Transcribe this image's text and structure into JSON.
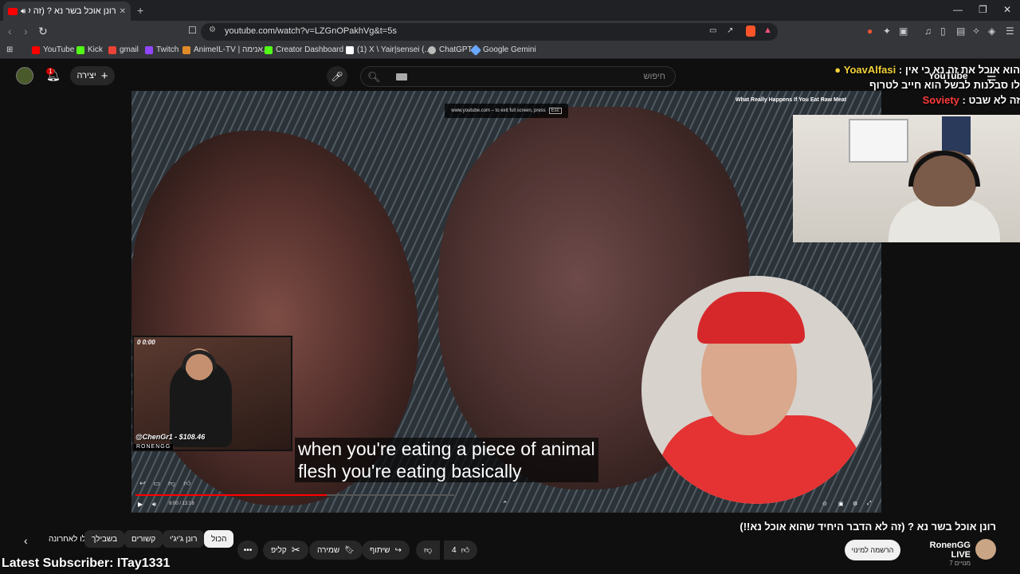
{
  "browser": {
    "tab_title": "רונן אוכל בשר נא ? (זה לא (1)",
    "new_tab_glyph": "+",
    "url": "youtube.com/watch?v=LZGnOPakhVg&t=5s",
    "window_controls": [
      "—",
      "❐",
      "✕"
    ],
    "bookmarks": [
      {
        "label": "YouTube",
        "color": "#ff0000"
      },
      {
        "label": "Kick",
        "color": "#53fc18"
      },
      {
        "label": "gmail",
        "color": "#ea4335"
      },
      {
        "label": "Twitch",
        "color": "#9146ff"
      },
      {
        "label": "AnimeIL-TV | אנימה...",
        "color": "#e08a2a"
      },
      {
        "label": "Creator Dashboard |...",
        "color": "#53fc18"
      },
      {
        "label": "(1) X \\ Yair|sensei (...",
        "color": "#ffffff"
      },
      {
        "label": "ChatGPT",
        "color": "#bbbbbb"
      },
      {
        "label": "Google Gemini",
        "color": "#6aa7ff"
      }
    ]
  },
  "youtube_header": {
    "create_label": "יצירה",
    "notification_count": "1",
    "search_placeholder": "חיפוש"
  },
  "player": {
    "fullscreen_hint": "www.youtube.com – to exit full screen, press",
    "esc_key": "Esc",
    "subtitle_line1": "when you're eating a piece of animal",
    "subtitle_line2": "flesh you're eating basically",
    "time": "8:00 / 13:16",
    "progress_fraction": 0.6,
    "streamer_stats": "0   0:00",
    "streamer_donor": "@ChenGr1 - $108.46",
    "streamer_tag": "RONENGG"
  },
  "chat_overlay": {
    "line1_user": "YoavAlfasi",
    "line1_text": "הוא אוכל את זה נא כי אין :",
    "line2_text": "לו סבלנות לבשל הוא חייב לטרוף",
    "line3_user": "Soviety",
    "line3_text": "זה לא שבט :",
    "video_title_overlay": "What Really Happens If You Eat Raw Meat",
    "yt_logo": "YouTube"
  },
  "video_info": {
    "title": "רונן אוכל בשר נא ? (זה לא הדבר היחיד שהוא אוכל נא!!)",
    "channel_name": "RonenGG LIVE",
    "subscribers": "7 מנויים",
    "subscribe_label": "הרשמה למינוי",
    "like_count": "4",
    "share_label": "שיתוף",
    "save_label": "שמירה",
    "clip_label": "קליפ",
    "chips": [
      "הכול",
      "רונן ג'יג'י",
      "קשורים",
      "בשבילך",
      "הועלו לאחרונה"
    ],
    "latest_subscriber": "Latest Subscriber: ITay1331"
  }
}
